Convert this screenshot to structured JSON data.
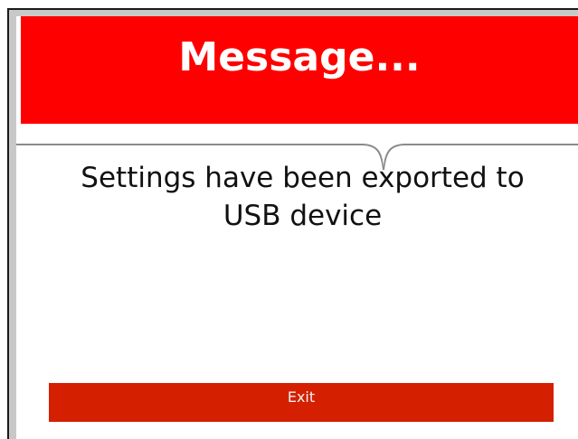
{
  "dialog": {
    "title": "Message...",
    "message": "Settings have been exported to USB device",
    "exit_label": "Exit"
  },
  "colors": {
    "header": "#ff0000",
    "button": "#d42000",
    "button_text": "#f3f3f3",
    "message_text": "#111111",
    "frame": "#c8c8c8"
  }
}
